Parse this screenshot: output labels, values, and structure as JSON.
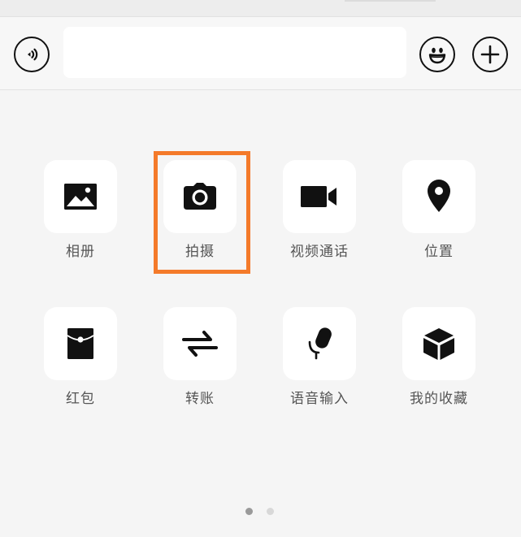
{
  "input_bar": {
    "message_value": "",
    "voice_icon": "voice-wave-icon",
    "emoji_icon": "smiley-icon",
    "plus_icon": "plus-icon"
  },
  "actions": [
    {
      "label": "相册",
      "icon": "photo-album-icon"
    },
    {
      "label": "拍摄",
      "icon": "camera-icon"
    },
    {
      "label": "视频通话",
      "icon": "video-camera-icon"
    },
    {
      "label": "位置",
      "icon": "location-pin-icon"
    },
    {
      "label": "红包",
      "icon": "red-envelope-icon"
    },
    {
      "label": "转账",
      "icon": "transfer-arrows-icon"
    },
    {
      "label": "语音输入",
      "icon": "microphone-icon"
    },
    {
      "label": "我的收藏",
      "icon": "favorites-cube-icon"
    }
  ],
  "highlighted_action": "拍摄",
  "colors": {
    "highlight": "#f47a2a",
    "icon": "#111111",
    "label": "#555555",
    "background": "#f5f5f5"
  },
  "pager": {
    "pages": 2,
    "current": 1
  }
}
